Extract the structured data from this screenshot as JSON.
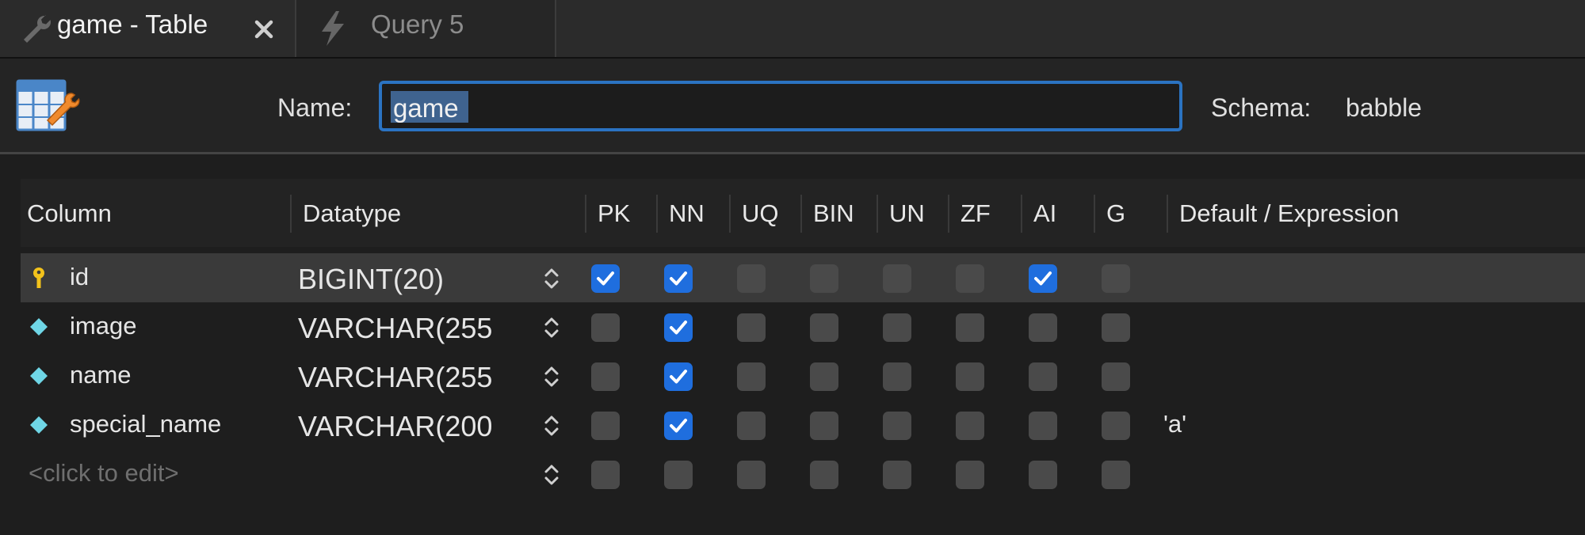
{
  "tabs": [
    {
      "label": "game - Table",
      "icon": "wrench-icon",
      "active": true
    },
    {
      "label": "Query 5",
      "icon": "lightning-icon",
      "active": false
    }
  ],
  "editor": {
    "name_label": "Name:",
    "name_value": "game",
    "schema_label": "Schema:",
    "schema_value": "babble"
  },
  "grid": {
    "headers": [
      "Column",
      "Datatype",
      "PK",
      "NN",
      "UQ",
      "BIN",
      "UN",
      "ZF",
      "AI",
      "G",
      "Default / Expression"
    ],
    "rows": [
      {
        "name": "id",
        "icon": "key-icon",
        "datatype": "BIGINT(20)",
        "flags": [
          true,
          true,
          false,
          false,
          false,
          false,
          true,
          false
        ],
        "default": "",
        "selected": true
      },
      {
        "name": "image",
        "icon": "diamond-icon",
        "datatype": "VARCHAR(255",
        "flags": [
          false,
          true,
          false,
          false,
          false,
          false,
          false,
          false
        ],
        "default": "",
        "selected": false
      },
      {
        "name": "name",
        "icon": "diamond-icon",
        "datatype": "VARCHAR(255",
        "flags": [
          false,
          true,
          false,
          false,
          false,
          false,
          false,
          false
        ],
        "default": "",
        "selected": false
      },
      {
        "name": "special_name",
        "icon": "diamond-icon",
        "datatype": "VARCHAR(200",
        "flags": [
          false,
          true,
          false,
          false,
          false,
          false,
          false,
          false
        ],
        "default": "'a'",
        "selected": false
      }
    ],
    "new_row_placeholder": "<click to edit>"
  },
  "colors": {
    "accent": "#2b73c2",
    "checkbox_on": "#1f6ede",
    "key_icon": "#f2c21b",
    "diamond_icon": "#6fd6e6"
  }
}
